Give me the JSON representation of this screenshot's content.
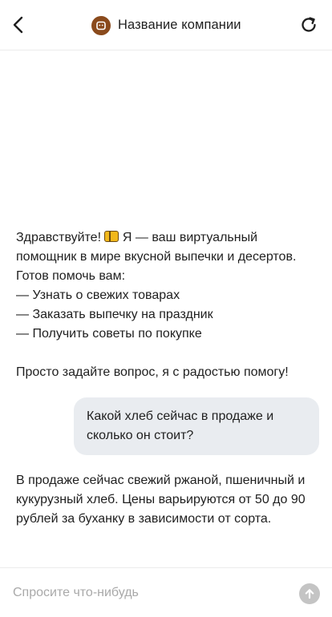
{
  "header": {
    "title": "Название компании",
    "back_icon": "chevron-left-icon",
    "refresh_icon": "refresh-icon",
    "logo_color": "#8a4a1c"
  },
  "messages": [
    {
      "role": "assistant",
      "before_icon": "Здравствуйте! ",
      "icon": "bread-icon",
      "after_icon": " Я — ваш виртуальный помощник в мире вкусной выпечки и десертов.\nГотов помочь вам:\n— Узнать о свежих товарах\n— Заказать выпечку на праздник\n— Получить советы по покупке\n\nПросто задайте вопрос, я с радостью помогу!"
    },
    {
      "role": "user",
      "text": "Какой хлеб сейчас в продаже и сколько он стоит?"
    },
    {
      "role": "assistant",
      "text": "В продаже сейчас свежий ржаной, пшеничный и кукурузный хлеб. Цены варьируются от 50 до 90 рублей за буханку в зависимости от сорта."
    }
  ],
  "composer": {
    "placeholder": "Спросите что-нибудь",
    "value": "",
    "send_icon": "send-arrow-icon"
  },
  "colors": {
    "user_bubble": "#e9ecf0",
    "send_button_disabled": "#c4c4c4"
  }
}
